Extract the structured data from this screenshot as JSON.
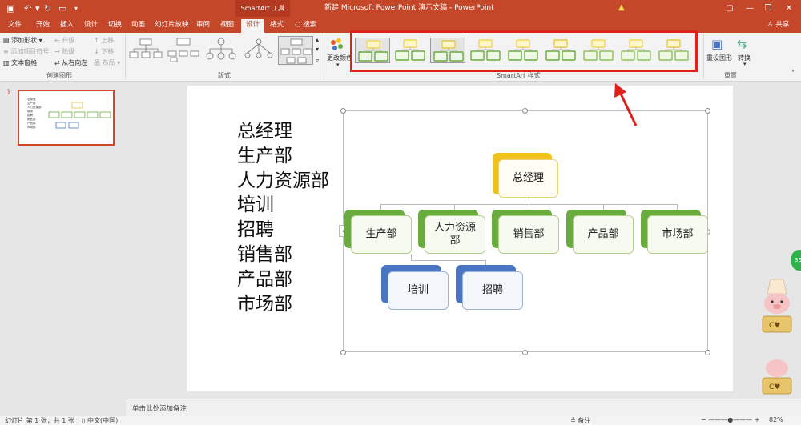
{
  "titlebar": {
    "smartart_tools": "SmartArt 工具",
    "document_title": "新建 Microsoft PowerPoint 演示文稿 - PowerPoint",
    "warning_icon": "warning-icon"
  },
  "tabs": [
    "文件",
    "开始",
    "插入",
    "设计",
    "切换",
    "动画",
    "幻灯片放映",
    "审阅",
    "视图",
    "设计",
    "格式"
  ],
  "search_label": "搜索",
  "share_label": "共享",
  "ribbon": {
    "create_graphic": {
      "add_shape": "添加形状",
      "add_bullet": "添加项目符号",
      "text_pane": "文本窗格",
      "promote": "升级",
      "demote": "降级",
      "right_to_left": "从右向左",
      "move_up": "上移",
      "move_down": "下移",
      "layout_label": "布局",
      "group_label": "创建图形"
    },
    "layouts_label": "版式",
    "change_colors": "更改颜色",
    "styles_label": "SmartArt 样式",
    "reset": {
      "reset_graphic": "重设图形",
      "convert": "转换",
      "group_label": "重置"
    }
  },
  "colors": {
    "brand": "#c4472a",
    "highlight_red": "#e0201b",
    "node_green": "#6aab3f",
    "node_yellow": "#f2c21b",
    "node_blue": "#4a76c1"
  },
  "slide_number": "1",
  "slide": {
    "text_lines": [
      "总经理",
      "生产部",
      "人力资源部",
      "培训",
      "招聘",
      "销售部",
      "产品部",
      "市场部"
    ],
    "org": {
      "top": "总经理",
      "level2": [
        "生产部",
        "人力资源部",
        "销售部",
        "产品部",
        "市场部"
      ],
      "level3": [
        "培训",
        "招聘"
      ]
    }
  },
  "notes_placeholder": "单击此处添加备注",
  "status": {
    "slide_info": "幻灯片 第 1 张，共 1 张",
    "language": "中文(中国)",
    "notes_btn": "备注",
    "zoom": "82%"
  }
}
